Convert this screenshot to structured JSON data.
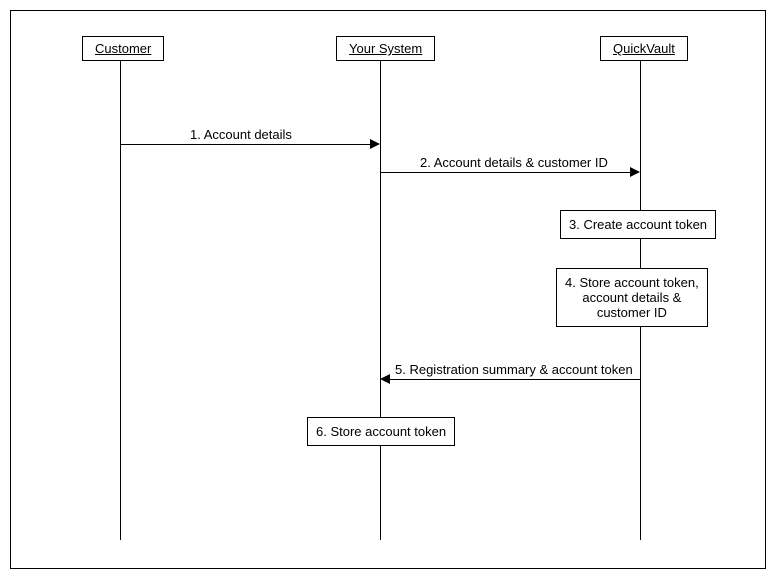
{
  "participants": {
    "customer": "Customer",
    "system": "Your System",
    "vault": "QuickVault"
  },
  "messages": {
    "m1": "1. Account details",
    "m2": "2. Account details & customer ID",
    "m3": "3. Create account token",
    "m4_line1": "4. Store account token,",
    "m4_line2": "account details &",
    "m4_line3": "customer ID",
    "m5": "5. Registration summary & account token",
    "m6": "6. Store account token"
  }
}
